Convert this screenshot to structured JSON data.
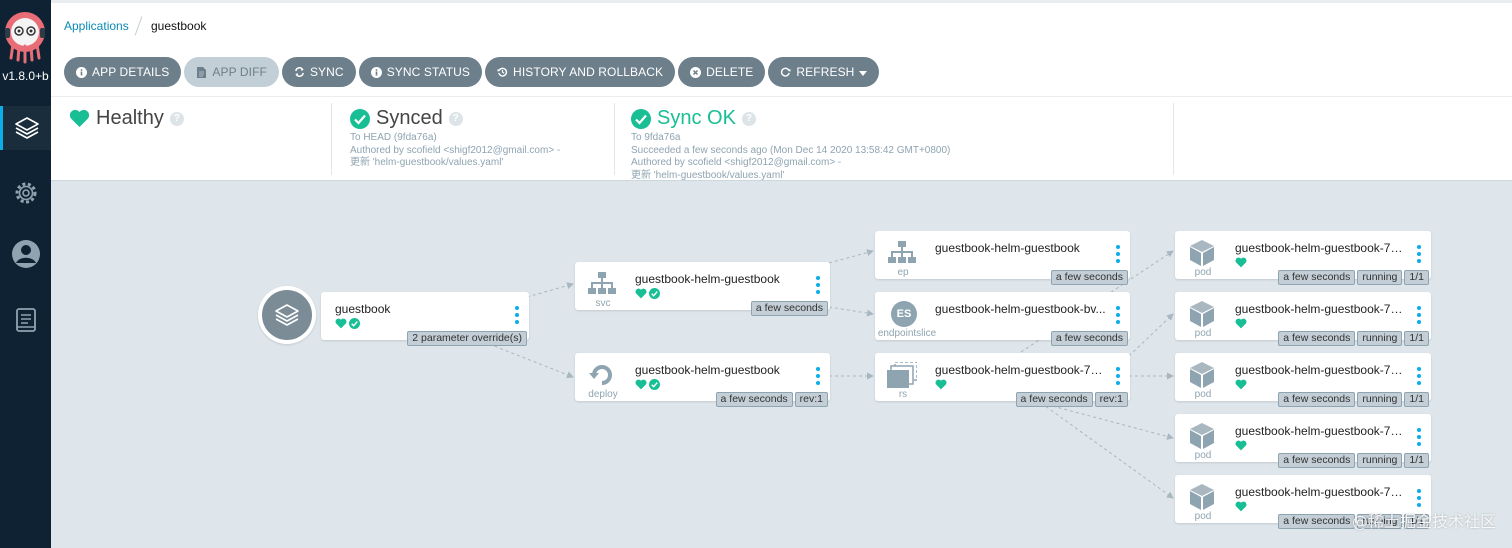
{
  "sidebar": {
    "version": "v1.8.0+b",
    "items": [
      {
        "icon": "layers-icon",
        "active": true
      },
      {
        "icon": "gear-icon",
        "active": false
      },
      {
        "icon": "user-icon",
        "active": false
      },
      {
        "icon": "docs-icon",
        "active": false
      }
    ]
  },
  "breadcrumb": {
    "root": "Applications",
    "current": "guestbook"
  },
  "toolbar": {
    "app_details": "APP DETAILS",
    "app_diff": "APP DIFF",
    "sync": "SYNC",
    "sync_status": "SYNC STATUS",
    "history": "HISTORY AND ROLLBACK",
    "delete": "DELETE",
    "refresh": "REFRESH"
  },
  "status": {
    "health": {
      "title": "Healthy"
    },
    "sync": {
      "title": "Synced",
      "line1": "To HEAD (9fda76a)",
      "line2": "Authored by scofield <shigf2012@gmail.com> -",
      "line3": "更新 'helm-guestbook/values.yaml'"
    },
    "operation": {
      "title": "Sync OK",
      "line1": "To 9fda76a",
      "line2": "Succeeded a few seconds ago (Mon Dec 14 2020 13:58:42 GMT+0800)",
      "line3": "Authored by scofield <shigf2012@gmail.com> -",
      "line4": "更新 'helm-guestbook/values.yaml'"
    }
  },
  "colors": {
    "accent": "#0dadea",
    "healthy": "#18be94",
    "sidebar": "#0e2233",
    "canvas": "#dee6eb",
    "button": "#6d7f8b"
  },
  "graph": {
    "app": {
      "name": "guestbook",
      "tag": "2 parameter override(s)"
    },
    "svc": {
      "name": "guestbook-helm-guestbook",
      "kind": "svc",
      "age": "a few seconds"
    },
    "deploy": {
      "name": "guestbook-helm-guestbook",
      "kind": "deploy",
      "age": "a few seconds",
      "rev": "rev:1"
    },
    "ep": {
      "name": "guestbook-helm-guestbook",
      "kind": "ep",
      "age": "a few seconds"
    },
    "eps": {
      "name": "guestbook-helm-guestbook-bv...",
      "kind": "endpointslice",
      "badge": "ES",
      "age": "a few seconds"
    },
    "rs": {
      "name": "guestbook-helm-guestbook-7b...",
      "kind": "rs",
      "age": "a few seconds",
      "rev": "rev:1"
    },
    "pods": [
      {
        "name": "guestbook-helm-guestbook-7b...",
        "kind": "pod",
        "age": "a few seconds",
        "state": "running",
        "ready": "1/1"
      },
      {
        "name": "guestbook-helm-guestbook-7b...",
        "kind": "pod",
        "age": "a few seconds",
        "state": "running",
        "ready": "1/1"
      },
      {
        "name": "guestbook-helm-guestbook-7b...",
        "kind": "pod",
        "age": "a few seconds",
        "state": "running",
        "ready": "1/1"
      },
      {
        "name": "guestbook-helm-guestbook-7b...",
        "kind": "pod",
        "age": "a few seconds",
        "state": "running",
        "ready": "1/1"
      },
      {
        "name": "guestbook-helm-guestbook-7b...",
        "kind": "pod",
        "age": "a few seconds",
        "state": "running",
        "ready": "1/1"
      }
    ]
  },
  "watermark": "@稀土掘金技术社区"
}
